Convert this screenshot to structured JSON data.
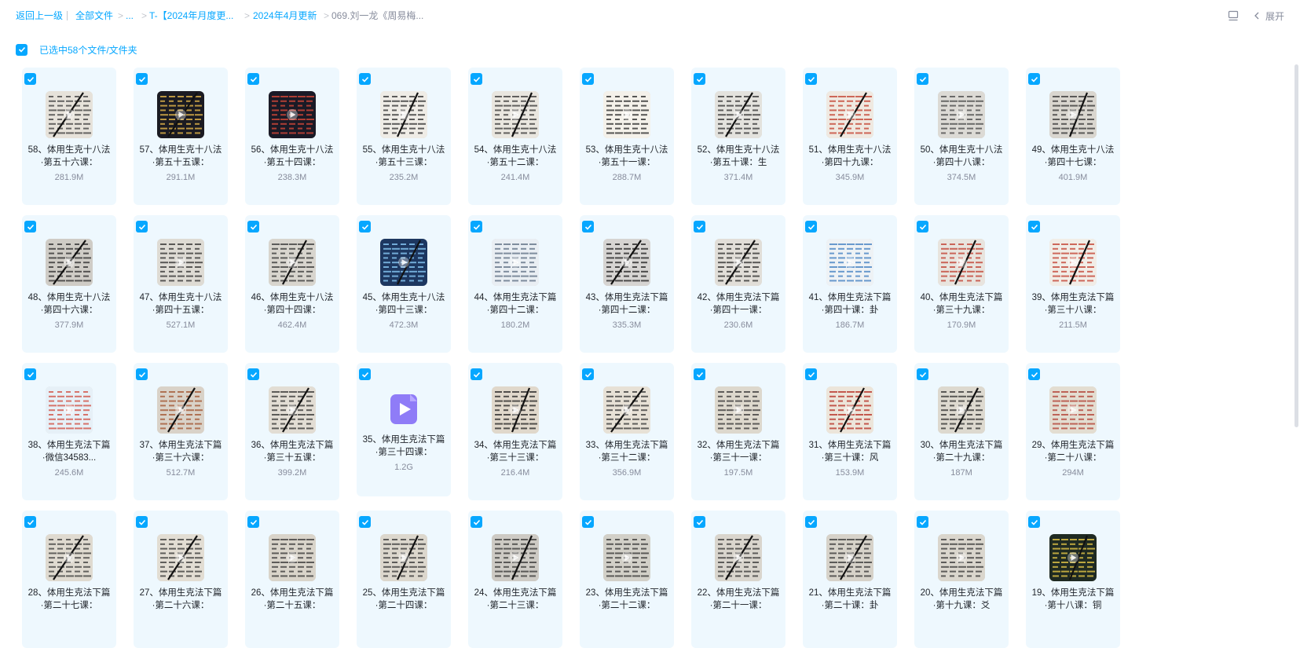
{
  "breadcrumb": {
    "back": "返回上一级",
    "all_files": "全部文件",
    "ellipsis": "...",
    "folder1": "T-【2024年月度更...",
    "folder2": "2024年4月更新",
    "current": "069.刘一龙《周易梅...",
    "separator": ">"
  },
  "toolbar": {
    "layout_icon": "layout-icon",
    "expand_label": "展开"
  },
  "selection": {
    "text": "已选中58个文件/文件夹"
  },
  "colors": {
    "accent": "#06a7ff",
    "card_bg": "#eef8fe",
    "muted": "#878c9c"
  },
  "files": [
    {
      "name": "58、体用生克十八法·第五十六课：",
      "size": "281.9M"
    },
    {
      "name": "57、体用生克十八法·第五十五课：",
      "size": "291.1M"
    },
    {
      "name": "56、体用生克十八法·第五十四课：",
      "size": "238.3M"
    },
    {
      "name": "55、体用生克十八法·第五十三课：",
      "size": "235.2M"
    },
    {
      "name": "54、体用生克十八法·第五十二课：",
      "size": "241.4M"
    },
    {
      "name": "53、体用生克十八法·第五十一课：",
      "size": "288.7M"
    },
    {
      "name": "52、体用生克十八法·第五十课：生",
      "size": "371.4M"
    },
    {
      "name": "51、体用生克十八法·第四十九课：",
      "size": "345.9M"
    },
    {
      "name": "50、体用生克十八法·第四十八课：",
      "size": "374.5M"
    },
    {
      "name": "49、体用生克十八法·第四十七课：",
      "size": "401.9M"
    },
    {
      "name": "48、体用生克十八法·第四十六课：",
      "size": "377.9M"
    },
    {
      "name": "47、体用生克十八法·第四十五课：",
      "size": "527.1M"
    },
    {
      "name": "46、体用生克十八法·第四十四课：",
      "size": "462.4M"
    },
    {
      "name": "45、体用生克十八法·第四十三课：",
      "size": "472.3M"
    },
    {
      "name": "44、体用生克法下篇·第四十二课：",
      "size": "180.2M"
    },
    {
      "name": "43、体用生克法下篇·第四十二课：",
      "size": "335.3M"
    },
    {
      "name": "42、体用生克法下篇·第四十一课：",
      "size": "230.6M"
    },
    {
      "name": "41、体用生克法下篇·第四十课：卦",
      "size": "186.7M"
    },
    {
      "name": "40、体用生克法下篇·第三十九课：",
      "size": "170.9M"
    },
    {
      "name": "39、体用生克法下篇·第三十八课：",
      "size": "211.5M"
    },
    {
      "name": "38、体用生克法下篇·微信34583...",
      "size": "245.6M"
    },
    {
      "name": "37、体用生克法下篇·第三十六课：",
      "size": "512.7M"
    },
    {
      "name": "36、体用生克法下篇·第三十五课：",
      "size": "399.2M"
    },
    {
      "name": "35、体用生克法下篇·第三十四课：",
      "size": "1.2G"
    },
    {
      "name": "34、体用生克法下篇·第三十三课：",
      "size": "216.4M"
    },
    {
      "name": "33、体用生克法下篇·第三十二课：",
      "size": "356.9M"
    },
    {
      "name": "32、体用生克法下篇·第三十一课：",
      "size": "197.5M"
    },
    {
      "name": "31、体用生克法下篇·第三十课：风",
      "size": "153.9M"
    },
    {
      "name": "30、体用生克法下篇·第二十九课：",
      "size": "187M"
    },
    {
      "name": "29、体用生克法下篇·第二十八课：",
      "size": "294M"
    },
    {
      "name": "28、体用生克法下篇·第二十七课：",
      "size": ""
    },
    {
      "name": "27、体用生克法下篇·第二十六课：",
      "size": ""
    },
    {
      "name": "26、体用生克法下篇·第二十五课：",
      "size": ""
    },
    {
      "name": "25、体用生克法下篇·第二十四课：",
      "size": ""
    },
    {
      "name": "24、体用生克法下篇·第二十三课：",
      "size": ""
    },
    {
      "name": "23、体用生克法下篇·第二十二课：",
      "size": ""
    },
    {
      "name": "22、体用生克法下篇·第二十一课：",
      "size": ""
    },
    {
      "name": "21、体用生克法下篇·第二十课：卦",
      "size": ""
    },
    {
      "name": "20、体用生克法下篇·第十九课：爻",
      "size": ""
    },
    {
      "name": "19、体用生克法下篇·第十八课：铜",
      "size": ""
    }
  ]
}
